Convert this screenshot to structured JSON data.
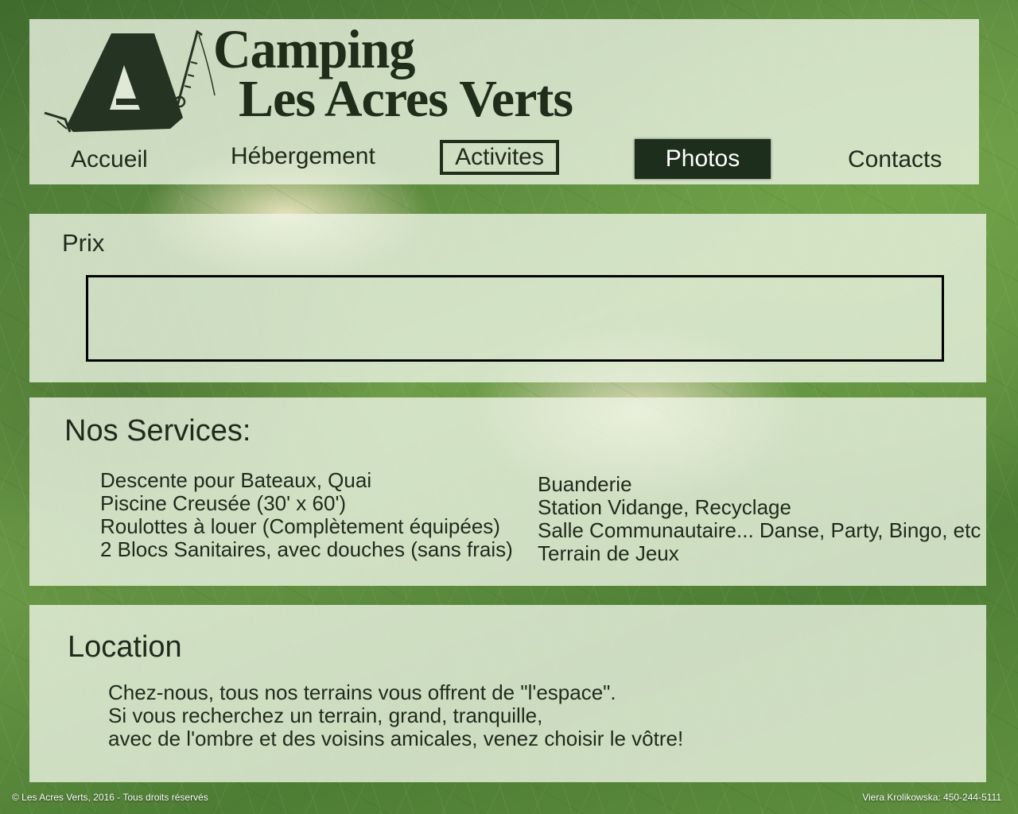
{
  "brand": {
    "line1": "Camping",
    "line2": "Les Acres Verts"
  },
  "nav": {
    "accueil": "Accueil",
    "hebergement": "Hébergement",
    "activites": "Activites",
    "photos": "Photos",
    "contacts": "Contacts"
  },
  "prix": {
    "title": "Prix"
  },
  "services": {
    "title": "Nos Services:",
    "left": [
      "Descente pour Bateaux, Quai",
      "Piscine Creusée (30' x 60')",
      "Roulottes à louer (Complètement équipées)",
      "2 Blocs Sanitaires, avec douches (sans frais)"
    ],
    "right": [
      "Buanderie",
      "Station Vidange, Recyclage",
      "Salle Communautaire... Danse, Party, Bingo, etc",
      "Terrain de Jeux"
    ]
  },
  "location": {
    "title": "Location",
    "lines": [
      "Chez-nous, tous nos terrains vous offrent de \"l'espace\".",
      "Si vous recherchez un terrain, grand, tranquille,",
      "avec de l'ombre et des voisins amicales, venez choisir le vôtre!"
    ]
  },
  "footer": {
    "copyright": "© Les Acres Verts, 2016 - Tous droits réservés",
    "contact": "Viera Krolikowska: 450-244-5111"
  },
  "colors": {
    "dark_green": "#1f2e1a",
    "panel": "#ecf4e4"
  },
  "icons": {
    "logo": "tent-fishing-rod-logo"
  }
}
